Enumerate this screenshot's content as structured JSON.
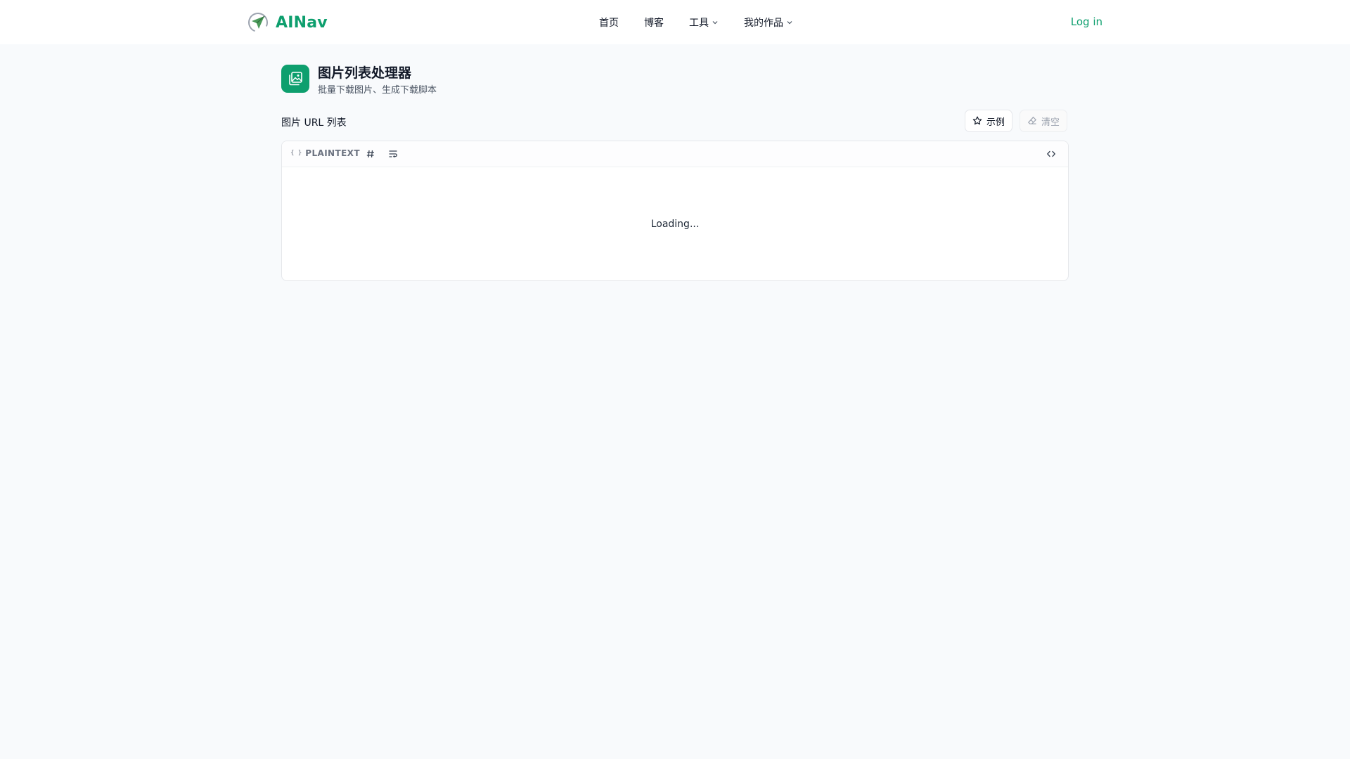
{
  "header": {
    "brand": "AINav",
    "nav": [
      {
        "label": "首页",
        "has_dropdown": false
      },
      {
        "label": "博客",
        "has_dropdown": false
      },
      {
        "label": "工具",
        "has_dropdown": true
      },
      {
        "label": "我的作品",
        "has_dropdown": true
      }
    ],
    "login_label": "Log in"
  },
  "page": {
    "title": "图片列表处理器",
    "subtitle": "批量下载图片、生成下载脚本"
  },
  "editor_section": {
    "label": "图片 URL 列表",
    "example_button": "示例",
    "clear_button": "清空",
    "language": "PLAINTEXT",
    "language_brace": "{ }",
    "loading_text": "Loading..."
  },
  "icons": {
    "logo": "paper-plane-logo-icon",
    "tool": "images-icon",
    "example": "star-icon",
    "clear": "eraser-icon",
    "line_numbers": "hash-icon",
    "word_wrap": "wrap-text-icon",
    "format": "code-icon",
    "dropdown": "chevron-down-icon"
  },
  "colors": {
    "brand": "#0e9f6e",
    "background": "#f8fafc",
    "border": "#e5e7eb"
  }
}
